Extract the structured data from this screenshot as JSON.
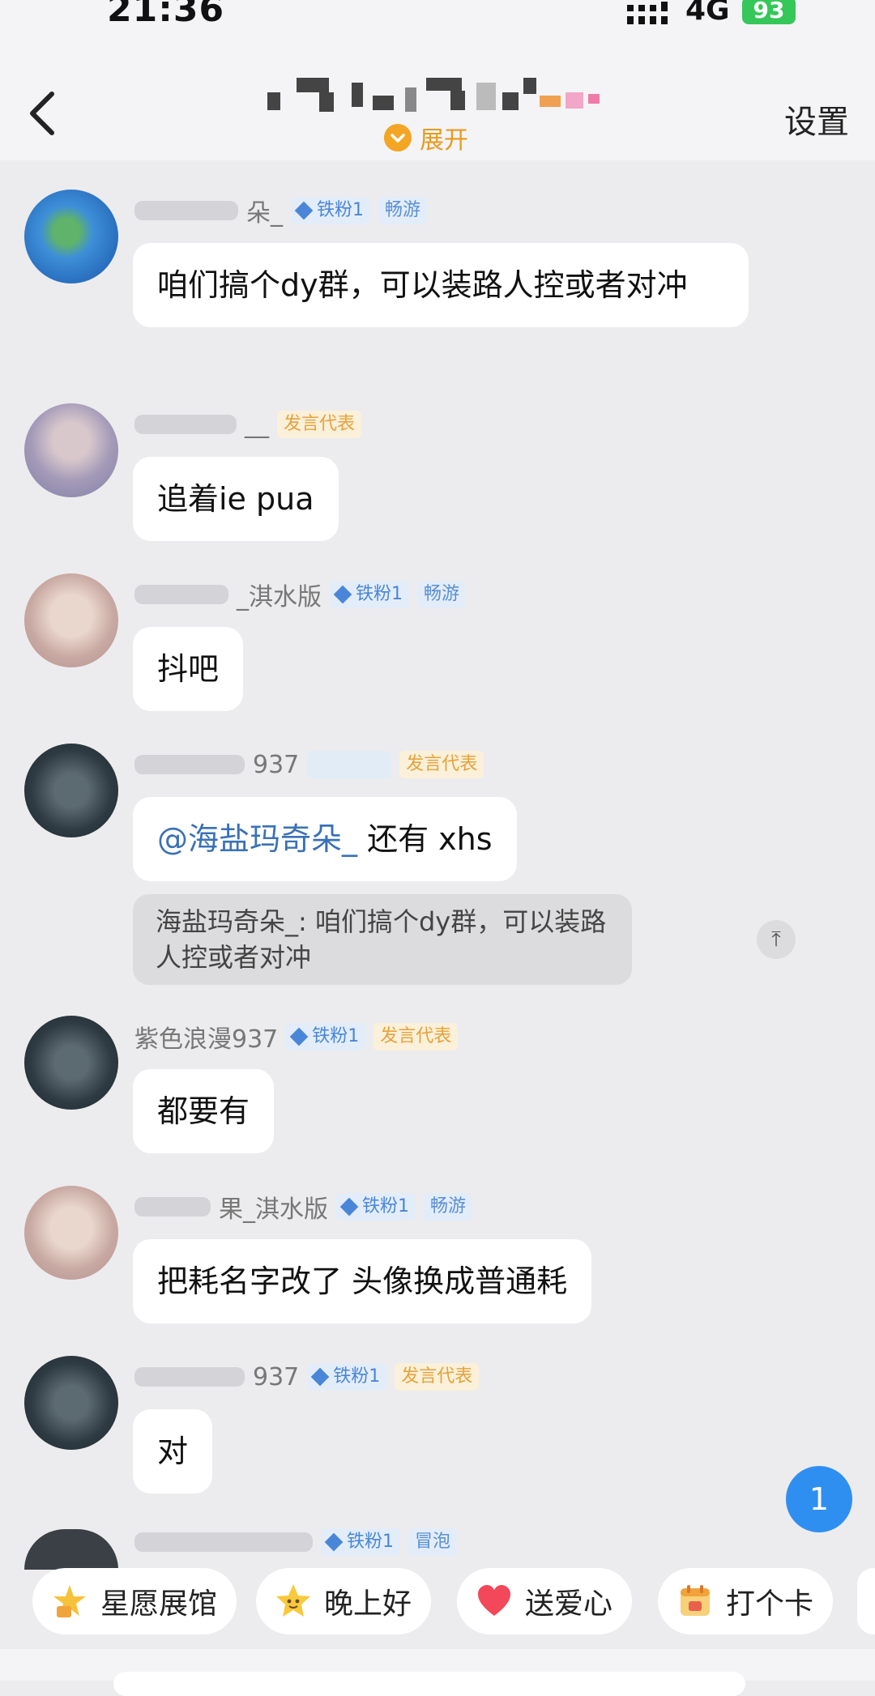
{
  "status_bar": {
    "time": "21:36",
    "network": "4G",
    "battery": "93"
  },
  "header": {
    "expand_label": "展开",
    "settings_label": "设置"
  },
  "messages": [
    {
      "name_suffix": "朵_",
      "badges": [
        "铁粉1",
        "畅游"
      ],
      "text": "咱们搞个dy群，可以装路人控或者对冲"
    },
    {
      "name_suffix": "__",
      "badges": [
        "发言代表"
      ],
      "text": "追着ie pua"
    },
    {
      "name_suffix": "_淇水版",
      "badges": [
        "铁粉1",
        "畅游"
      ],
      "text": "抖吧"
    },
    {
      "name_suffix": "937",
      "badges": [
        "发言代表"
      ],
      "mention": "@海盐玛奇朵_",
      "text": " 还有 xhs",
      "quote": "海盐玛奇朵_: 咱们搞个dy群，可以装路人控或者对冲",
      "quote_jump": "⤒"
    },
    {
      "name": "紫色浪漫937",
      "badges": [
        "铁粉1",
        "发言代表"
      ],
      "text": "都要有"
    },
    {
      "name_suffix": "果_淇水版",
      "badges": [
        "铁粉1",
        "畅游"
      ],
      "text": "把耗名字改了 头像换成普通耗"
    },
    {
      "name_suffix": "937",
      "badges": [
        "铁粉1",
        "发言代表"
      ],
      "text": "对"
    },
    {
      "badges": [
        "铁粉1",
        "冒泡"
      ]
    }
  ],
  "unread_count": "1",
  "quick_actions": [
    {
      "label": "星愿展馆",
      "icon": "star-wish-icon"
    },
    {
      "label": "晚上好",
      "icon": "star-face-icon"
    },
    {
      "label": "送爱心",
      "icon": "heart-icon"
    },
    {
      "label": "打个卡",
      "icon": "calendar-checkin-icon"
    }
  ],
  "colors": {
    "accent_orange": "#e89a1d",
    "mention_blue": "#3a71b6",
    "unread_blue": "#2f8ff0"
  }
}
